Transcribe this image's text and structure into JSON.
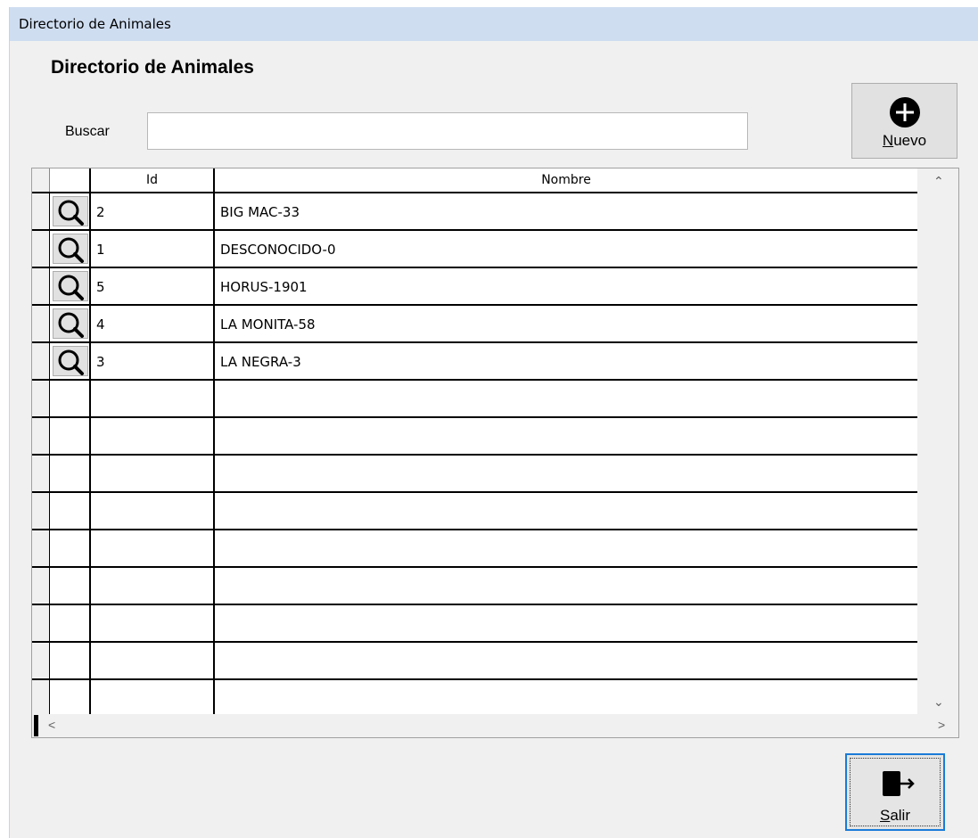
{
  "window": {
    "title": "Directorio de Animales"
  },
  "heading": "Directorio de Animales",
  "search": {
    "label": "Buscar",
    "value": ""
  },
  "buttons": {
    "new": {
      "label_hotkey": "N",
      "label_rest": "uevo",
      "icon": "plus-circle-icon"
    },
    "exit": {
      "label_hotkey": "S",
      "label_rest": "alir",
      "icon": "exit-door-icon"
    }
  },
  "table": {
    "columns": [
      "Id",
      "Nombre"
    ],
    "rows": [
      {
        "id": "2",
        "name": "BIG MAC-33"
      },
      {
        "id": "1",
        "name": "DESCONOCIDO-0"
      },
      {
        "id": "5",
        "name": "HORUS-1901"
      },
      {
        "id": "4",
        "name": "LA MONITA-58"
      },
      {
        "id": "3",
        "name": "LA NEGRA-3"
      }
    ],
    "empty_rows": 9
  },
  "scrollbar": {
    "up": "⌃",
    "down": "⌄",
    "left": "<",
    "right": ">"
  }
}
